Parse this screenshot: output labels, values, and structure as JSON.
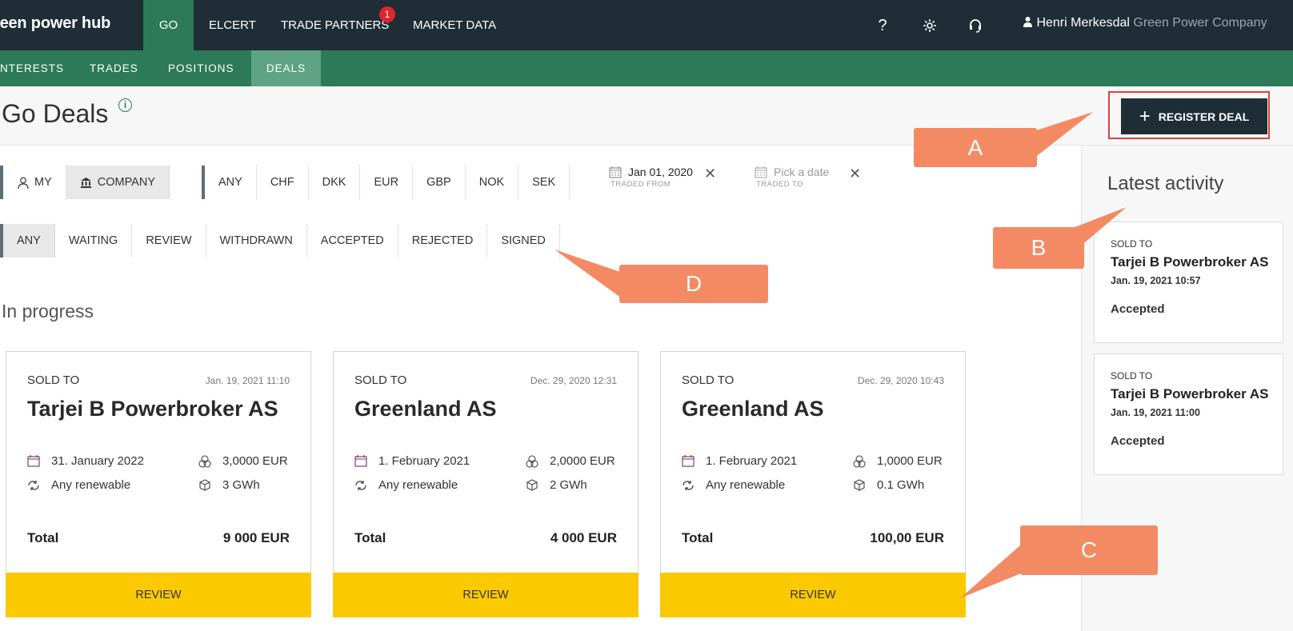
{
  "brand": "reen power hub",
  "nav": {
    "items": [
      "GO",
      "ELCERT",
      "TRADE PARTNERS",
      "MARKET DATA"
    ],
    "badge": "1",
    "help": "?"
  },
  "user": {
    "name": "Henri Merkesdal",
    "company": "Green Power Company"
  },
  "subnav": [
    "NTERESTS",
    "TRADES",
    "POSITIONS",
    "DEALS"
  ],
  "page": {
    "title": "Go Deals",
    "info": "i",
    "register_label": "REGISTER DEAL",
    "register_plus": "+"
  },
  "filters": {
    "owner": [
      "MY",
      "COMPANY"
    ],
    "currencies": [
      "ANY",
      "CHF",
      "DKK",
      "EUR",
      "GBP",
      "NOK",
      "SEK"
    ],
    "statuses": [
      "ANY",
      "WAITING",
      "REVIEW",
      "WITHDRAWN",
      "ACCEPTED",
      "REJECTED",
      "SIGNED"
    ],
    "traded_from": {
      "value": "Jan 01, 2020",
      "label": "TRADED FROM"
    },
    "traded_to": {
      "placeholder": "Pick a date",
      "label": "TRADED TO"
    },
    "clear": "✕"
  },
  "section_title": "In progress",
  "deals": [
    {
      "sold_to": "SOLD TO",
      "timestamp": "Jan. 19, 2021 11:10",
      "counterparty": "Tarjei B Powerbroker AS",
      "date": "31. January 2022",
      "price": "3,0000 EUR",
      "source": "Any renewable",
      "volume": "3 GWh",
      "total_label": "Total",
      "total": "9 000 EUR",
      "action": "REVIEW"
    },
    {
      "sold_to": "SOLD TO",
      "timestamp": "Dec. 29, 2020 12:31",
      "counterparty": "Greenland AS",
      "date": "1. February 2021",
      "price": "2,0000 EUR",
      "source": "Any renewable",
      "volume": "2 GWh",
      "total_label": "Total",
      "total": "4 000 EUR",
      "action": "REVIEW"
    },
    {
      "sold_to": "SOLD TO",
      "timestamp": "Dec. 29, 2020 10:43",
      "counterparty": "Greenland AS",
      "date": "1. February 2021",
      "price": "1,0000 EUR",
      "source": "Any renewable",
      "volume": "0.1 GWh",
      "total_label": "Total",
      "total": "100,00 EUR",
      "action": "REVIEW"
    }
  ],
  "activity": {
    "title": "Latest activity",
    "items": [
      {
        "label": "SOLD TO",
        "name": "Tarjei B Powerbroker AS",
        "time": "Jan. 19, 2021 10:57",
        "status": "Accepted"
      },
      {
        "label": "SOLD TO",
        "name": "Tarjei B Powerbroker AS",
        "time": "Jan. 19, 2021 11:00",
        "status": "Accepted"
      }
    ]
  },
  "callouts": [
    "A",
    "B",
    "C",
    "D"
  ],
  "colors": {
    "topbar": "#1f2e36",
    "accent": "#2d7a5a",
    "callout": "#f48a63",
    "review": "#fbc900",
    "highlight_frame": "#e0403a"
  }
}
